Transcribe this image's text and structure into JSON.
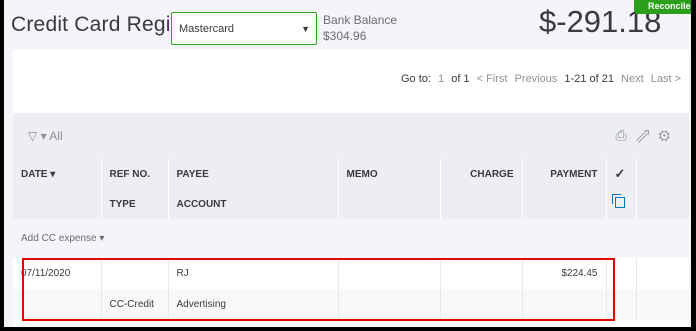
{
  "header": {
    "title": "Credit Card Register",
    "account_value": "Mastercard",
    "bank_balance_label": "Bank Balance",
    "bank_balance_value": "$304.96",
    "register_balance": "$-291.18",
    "action_button_label": "Reconcile"
  },
  "pager": {
    "goto_label": "Go to:",
    "page": "1",
    "of": "of 1",
    "first": "< First",
    "previous": "Previous",
    "range": "1-21 of 21",
    "next": "Next",
    "last": "Last >"
  },
  "toolbar": {
    "filter_label": "▾ All"
  },
  "columns": {
    "date": "DATE ▾",
    "ref": "REF NO.",
    "type": "TYPE",
    "payee": "PAYEE",
    "account": "ACCOUNT",
    "memo": "MEMO",
    "charge": "CHARGE",
    "payment": "PAYMENT",
    "check": "✓"
  },
  "add_row": {
    "label": "Add CC expense ▾"
  },
  "transactions": [
    {
      "date": "07/11/2020",
      "ref": "",
      "payee": "RJ",
      "memo": "",
      "charge": "",
      "payment": "$224.45",
      "type": "CC-Credit",
      "account": "Advertising"
    }
  ],
  "colors": {
    "accent_green": "#2ca01c",
    "highlight_red": "#e10600",
    "link_blue": "#0077c5"
  }
}
